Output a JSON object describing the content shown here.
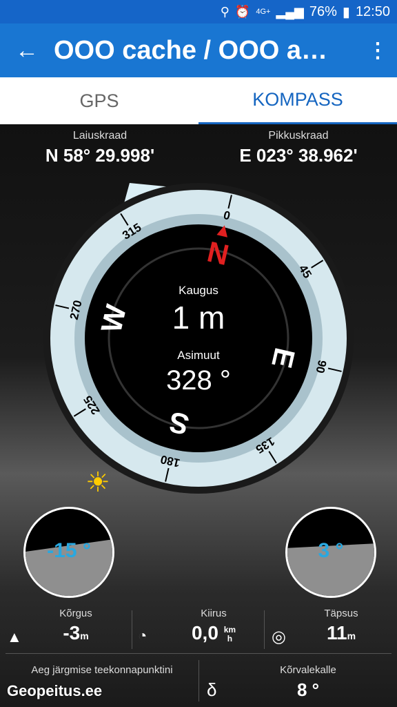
{
  "status": {
    "icons": [
      "location-icon",
      "alarm-icon",
      "lte-icon",
      "signal-icon"
    ],
    "lte": "4G+",
    "battery": "76%",
    "time": "12:50"
  },
  "appbar": {
    "title": "OOO cache / OOO a…"
  },
  "tabs": [
    {
      "label": "GPS"
    },
    {
      "label": "KOMPASS"
    }
  ],
  "coords": {
    "lat_label": "Laiuskraad",
    "lat_value": "N 58° 29.998'",
    "lon_label": "Pikkuskraad",
    "lon_value": "E 023° 38.962'"
  },
  "compass": {
    "distance_label": "Kaugus",
    "distance_value": "1 m",
    "azimuth_label": "Asimuut",
    "azimuth_value": "328 °",
    "letters": {
      "n": "N",
      "e": "E",
      "s": "S",
      "w": "W"
    },
    "ticks": [
      "0",
      "45",
      "90",
      "135",
      "180",
      "225",
      "270",
      "315"
    ],
    "colors": {
      "ring": "#cfe3ea",
      "north": "#e02020",
      "face": "#000000"
    }
  },
  "incline_left": {
    "value": "-15 °"
  },
  "incline_right": {
    "value": "3 °"
  },
  "stats": {
    "altitude_label": "Kõrgus",
    "altitude_value": "-3",
    "altitude_unit": "m",
    "speed_label": "Kiirus",
    "speed_value": "0,0",
    "speed_unit_top": "km",
    "speed_unit_bottom": "h",
    "accuracy_label": "Täpsus",
    "accuracy_value": "11",
    "accuracy_unit": "m"
  },
  "bottom": {
    "next_wp_label": "Aeg järgmise teekonnapunktini",
    "deviation_label": "Kõrvalekalle",
    "deviation_value": "8 °"
  },
  "logo": "Geopeitus.ee"
}
